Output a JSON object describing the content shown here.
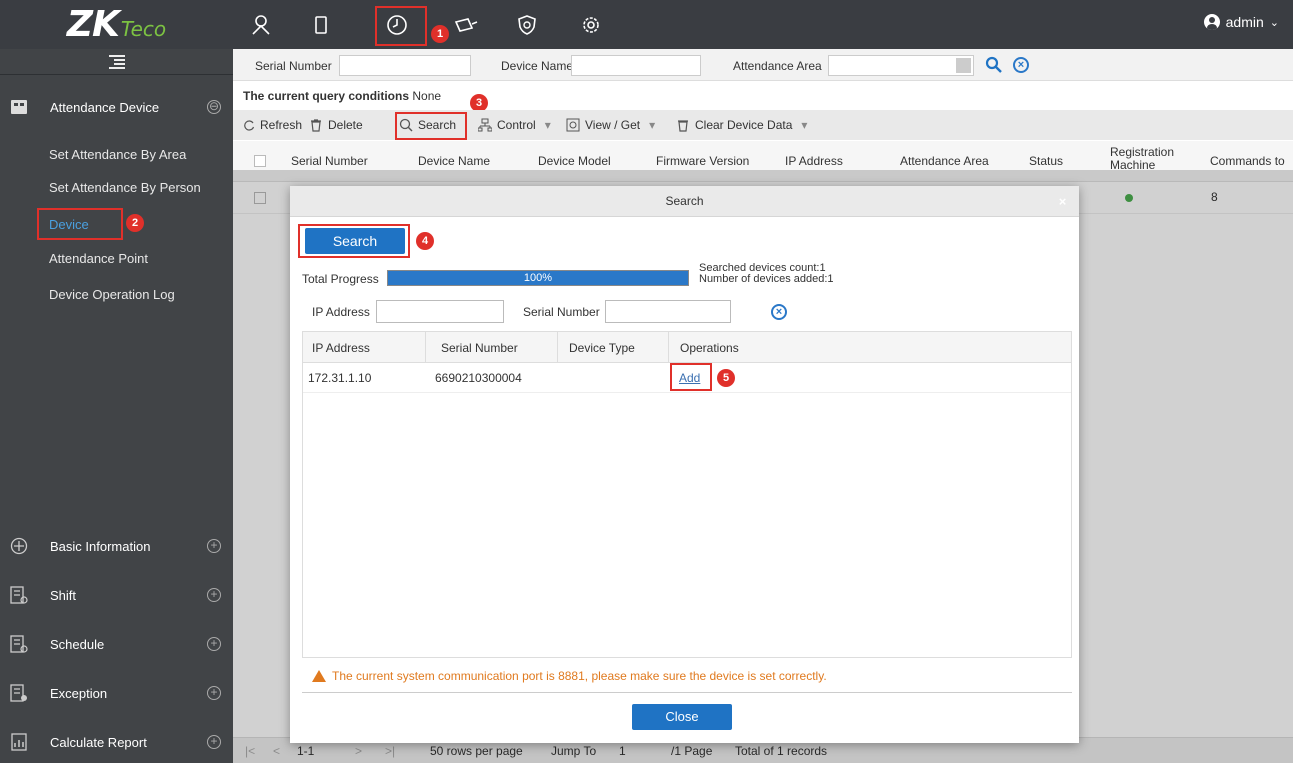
{
  "brand": {
    "logo_main": "ZK",
    "logo_suffix": "Teco"
  },
  "top_nav": {
    "user_name": "admin",
    "user_caret": "⌄"
  },
  "badges": [
    "1",
    "2",
    "3",
    "4",
    "5"
  ],
  "sidebar": {
    "active_group": {
      "label": "Attendance Device",
      "toggle": "⊖"
    },
    "items": [
      {
        "label": "Set Attendance By Area"
      },
      {
        "label": "Set Attendance By Person"
      },
      {
        "label": "Device"
      },
      {
        "label": "Attendance Point"
      },
      {
        "label": "Device Operation Log"
      }
    ],
    "groups": [
      {
        "label": "Basic Information",
        "toggle": "+"
      },
      {
        "label": "Shift",
        "toggle": "+"
      },
      {
        "label": "Schedule",
        "toggle": "+"
      },
      {
        "label": "Exception",
        "toggle": "+"
      },
      {
        "label": "Calculate Report",
        "toggle": "+"
      }
    ]
  },
  "query": {
    "serial_label": "Serial Number",
    "name_label": "Device Name",
    "area_label": "Attendance Area",
    "conditions_label": "The current query conditions",
    "conditions_value": "None"
  },
  "toolbar": {
    "refresh": "Refresh",
    "delete": "Delete",
    "search": "Search",
    "control": "Control",
    "view_get": "View / Get",
    "clear_data": "Clear Device Data",
    "caret": "▾"
  },
  "table": {
    "columns": [
      "Serial Number",
      "Device Name",
      "Device Model",
      "Firmware Version",
      "IP Address",
      "Attendance Area",
      "Status",
      "Registration Machine",
      "Commands to"
    ],
    "row": {
      "commands": "8"
    }
  },
  "pager": {
    "first": "|<",
    "prev": "<",
    "range": "1-1",
    "next": ">",
    "last": ">|",
    "rows_per_page": "50 rows per page",
    "jump_label": "Jump To",
    "jump_value": "1",
    "page_count": "/1 Page",
    "total": "Total of 1 records"
  },
  "modal": {
    "title": "Search",
    "close_x": "×",
    "search_button": "Search",
    "progress_label": "Total Progress",
    "progress_percent": 100,
    "progress_text": "100%",
    "searched_count": "Searched devices count:1",
    "added_count": "Number of devices added:1",
    "ip_label": "IP Address",
    "serial_label": "Serial Number",
    "columns": [
      "IP Address",
      "Serial Number",
      "Device Type",
      "Operations"
    ],
    "results": [
      {
        "ip": "172.31.1.10",
        "serial": "6690210300004",
        "type": "",
        "operation": "Add"
      }
    ],
    "warning": "The current system communication port is 8881, please make sure the device is set correctly.",
    "close_button": "Close"
  },
  "colors": {
    "accent": "#1f73c4",
    "highlight": "#e0302a",
    "warning": "#e07a1f",
    "topbar": "#3a3d42",
    "sidebar": "#414447"
  }
}
